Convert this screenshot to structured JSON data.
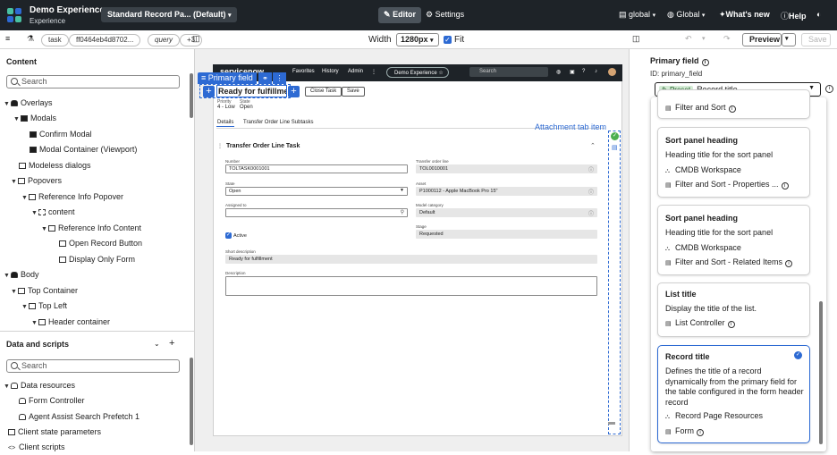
{
  "topbar": {
    "app_name": "Demo Experience",
    "app_subtitle": "Experience",
    "page_selector": "Standard Record Pa... (Default)",
    "editor": "Editor",
    "settings": "Settings",
    "scope": "global",
    "app_scope": "Global",
    "whats_new": "What's new",
    "help": "Help"
  },
  "toolbar": {
    "pills": [
      "task",
      "ff0464eb4d8702...",
      "query",
      "+3"
    ],
    "width_label": "Width",
    "width_value": "1280px",
    "fit_label": "Fit",
    "preview": "Preview",
    "save": "Save"
  },
  "content_panel": {
    "title": "Content",
    "search_placeholder": "Search",
    "tree": [
      {
        "label": "Overlays"
      },
      {
        "label": "Modals"
      },
      {
        "label": "Confirm Modal"
      },
      {
        "label": "Modal Container (Viewport)"
      },
      {
        "label": "Modeless dialogs"
      },
      {
        "label": "Popovers"
      },
      {
        "label": "Reference Info Popover"
      },
      {
        "label": "content"
      },
      {
        "label": "Reference Info Content"
      },
      {
        "label": "Open Record Button"
      },
      {
        "label": "Display Only Form"
      },
      {
        "label": "Body"
      },
      {
        "label": "Top Container"
      },
      {
        "label": "Top Left"
      },
      {
        "label": "Header container"
      }
    ]
  },
  "data_panel": {
    "title": "Data and scripts",
    "search_placeholder": "Search",
    "tree": [
      {
        "label": "Data resources"
      },
      {
        "label": "Form Controller"
      },
      {
        "label": "Agent Assist Search Prefetch 1"
      },
      {
        "label": "Client state parameters"
      },
      {
        "label": "Client scripts"
      }
    ]
  },
  "canvas": {
    "sn_logo": "servicenow",
    "nav": [
      "Favorites",
      "History",
      "Admin"
    ],
    "demo_pill": "Demo Experience",
    "search_placeholder": "Search",
    "primary_field_chip": "Primary field",
    "record_title": "Ready for fulfillment",
    "close_task": "Close Task",
    "save": "Save",
    "priority_label": "Priority",
    "priority_value": "4 - Low",
    "state_label": "State",
    "state_value": "Open",
    "tabs": [
      "Details",
      "Transfer Order Line Subtasks"
    ],
    "attachment_tab": "Attachment tab item",
    "section_title": "Transfer Order Line Task",
    "fields": {
      "number_label": "Number",
      "number_value": "TOLTASK0001001",
      "tol_label": "Transfer order line",
      "tol_value": "TOL0010001",
      "state_label": "State",
      "state_value": "Open",
      "asset_label": "Asset",
      "asset_value": "P1000112 - Apple MacBook Pro 15\"",
      "assigned_label": "Assigned to",
      "assigned_value": "",
      "model_cat_label": "Model category",
      "model_cat_value": "Default",
      "stage_label": "Stage",
      "stage_value": "Requested",
      "active_label": "Active",
      "short_desc_label": "Short description",
      "short_desc_value": "Ready for fulfillment",
      "desc_label": "Description",
      "desc_value": ""
    }
  },
  "config_panel": {
    "title": "Primary field",
    "id_text": "ID: primary_field",
    "preset_tag": "Preset",
    "selected_value": "Record title",
    "cards": [
      {
        "heading": "",
        "description": "",
        "meta": [
          "Filter and Sort"
        ]
      },
      {
        "heading": "Sort panel heading",
        "description": "Heading title for the sort panel",
        "meta": [
          "CMDB Workspace",
          "Filter and Sort - Properties ..."
        ]
      },
      {
        "heading": "Sort panel heading",
        "description": "Heading title for the sort panel",
        "meta": [
          "CMDB Workspace",
          "Filter and Sort - Related Items"
        ]
      },
      {
        "heading": "List title",
        "description": "Display the title of the list.",
        "meta": [
          "List Controller"
        ]
      },
      {
        "heading": "Record title",
        "description": "Defines the title of a record dynamically from the primary field for the table configured in the form header record",
        "meta": [
          "Record Page Resources",
          "Form"
        ]
      }
    ]
  },
  "colors": {
    "accent": "#2d6ad3",
    "topbar": "#1e2328"
  }
}
